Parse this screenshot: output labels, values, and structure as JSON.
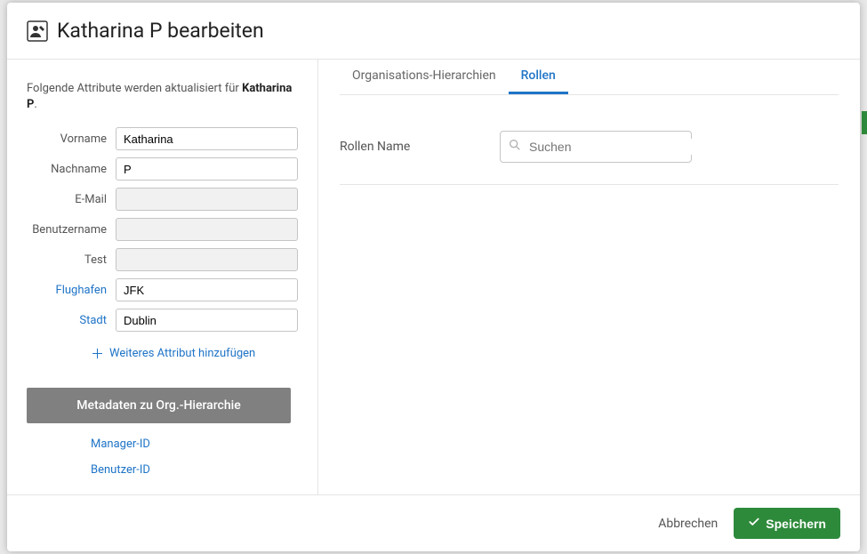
{
  "header": {
    "title": "Katharina P bearbeiten"
  },
  "intro": {
    "prefix": "Folgende Attribute werden aktualisiert für ",
    "name": "Katharina P",
    "suffix": "."
  },
  "fields": {
    "vorname": {
      "label": "Vorname",
      "value": "Katharina"
    },
    "nachname": {
      "label": "Nachname",
      "value": "P"
    },
    "email": {
      "label": "E-Mail",
      "value": ""
    },
    "benutzername": {
      "label": "Benutzername",
      "value": ""
    },
    "test": {
      "label": "Test",
      "value": ""
    },
    "flughafen": {
      "label": "Flughafen",
      "value": "JFK"
    },
    "stadt": {
      "label": "Stadt",
      "value": "Dublin"
    }
  },
  "add_attr": "Weiteres Attribut hinzufügen",
  "meta_button": "Metadaten zu Org.-Hierarchie",
  "meta_links": {
    "manager_id": "Manager-ID",
    "benutzer_id": "Benutzer-ID"
  },
  "tabs": {
    "org": "Organisations-Hierarchien",
    "rollen": "Rollen"
  },
  "roles": {
    "label": "Rollen Name",
    "search_placeholder": "Suchen"
  },
  "footer": {
    "cancel": "Abbrechen",
    "save": "Speichern"
  }
}
